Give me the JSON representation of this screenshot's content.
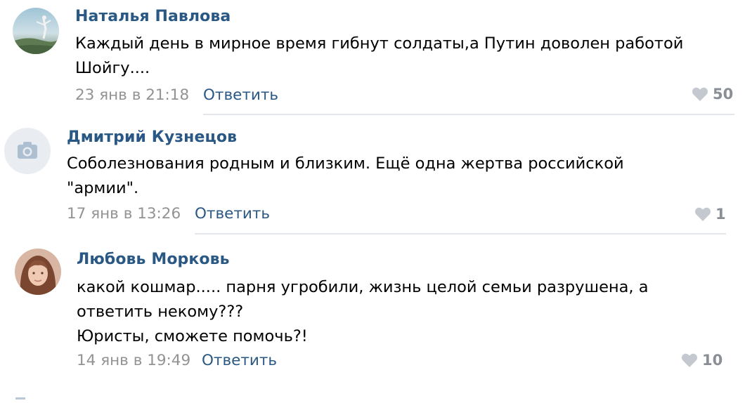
{
  "comments": [
    {
      "author": "Наталья Павлова",
      "avatar": "user-photo-landscape",
      "text": "Каждый день в мирное время гибнут солдаты,а Путин доволен работой\nШойгу....",
      "date": "23 янв в 21:18",
      "reply_label": "Ответить",
      "likes": "50"
    },
    {
      "author": "Дмитрий Кузнецов",
      "avatar": "camera-placeholder-icon",
      "text": "Соболезнования родным и близким. Ещё одна жертва российской\n\"армии\".",
      "date": "17 янв в 13:26",
      "reply_label": "Ответить",
      "likes": "1"
    },
    {
      "author": "Любовь Морковь",
      "avatar": "user-photo-portrait",
      "text": "какой кошмар..... парня угробили, жизнь целой семьи разрушена, а\nответить некому???\nЮристы, сможете помочь?!",
      "date": "14 янв в 19:49",
      "reply_label": "Ответить",
      "likes": "10"
    }
  ],
  "colors": {
    "author": "#2a5885",
    "date": "#939393",
    "likes": "#8a8f96",
    "divider": "#e3e6ea"
  }
}
